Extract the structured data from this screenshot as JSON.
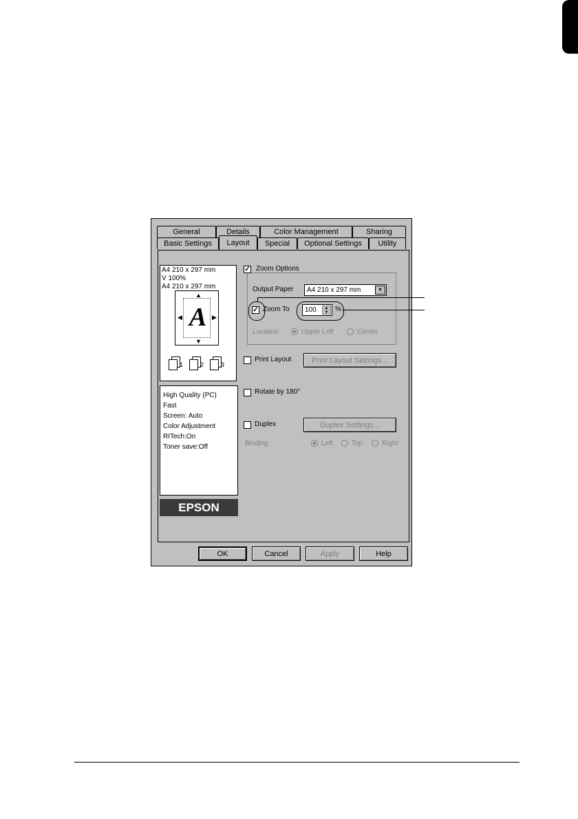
{
  "tabs_row1": [
    "General",
    "Details",
    "Color Management",
    "Sharing"
  ],
  "tabs_row2": [
    "Basic Settings",
    "Layout",
    "Special",
    "Optional Settings",
    "Utility"
  ],
  "preview": {
    "line1": "A4 210 x 297 mm",
    "line2": "V 100%",
    "line3": "A4 210 x 297 mm",
    "letter": "A",
    "stack_numbers": [
      "1",
      "2",
      "3"
    ]
  },
  "info_lines": [
    "High Quality (PC)",
    "Fast",
    "Screen: Auto",
    "Color Adjustment",
    "RITech:On",
    "Toner save:Off"
  ],
  "logo": "EPSON",
  "zoom": {
    "options_label": "Zoom Options",
    "output_paper_label": "Output Paper",
    "output_paper_value": "A4 210 x 297 mm",
    "zoom_to_label": "Zoom To",
    "zoom_value": "100",
    "percent": "%",
    "location_label": "Location",
    "upper_left": "Upper Left",
    "center": "Center"
  },
  "print_layout": {
    "label": "Print Layout",
    "button": "Print Layout Settings..."
  },
  "rotate": {
    "label": "Rotate by 180°"
  },
  "duplex": {
    "label": "Duplex",
    "button": "Duplex Settings...",
    "binding_label": "Binding",
    "left": "Left",
    "top": "Top",
    "right": "Right"
  },
  "buttons": {
    "ok": "OK",
    "cancel": "Cancel",
    "apply": "Apply",
    "help": "Help"
  },
  "colors": {
    "dialog_bg": "#c0c0c0",
    "logo_bg": "#3a3a3a"
  }
}
